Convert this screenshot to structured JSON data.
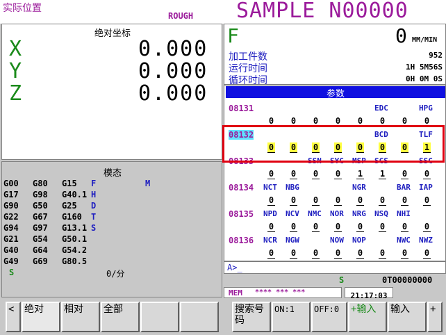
{
  "header": {
    "screen_title": "实际位置",
    "mode": "ROUGH",
    "program": "SAMPLE N00000"
  },
  "position": {
    "title": "绝对坐标",
    "axes": [
      {
        "letter": "X",
        "value": "0.000"
      },
      {
        "letter": "Y",
        "value": "0.000"
      },
      {
        "letter": "Z",
        "value": "0.000"
      }
    ]
  },
  "modal": {
    "title": "模态",
    "rows": [
      [
        "G00",
        "G80",
        "G15",
        "F",
        "M"
      ],
      [
        "G17",
        "G98",
        "G40.1",
        "H",
        ""
      ],
      [
        "G90",
        "G50",
        "G25",
        "D",
        ""
      ],
      [
        "G22",
        "G67",
        "G160",
        "T",
        ""
      ],
      [
        "G94",
        "G97",
        "G13.1",
        "S",
        ""
      ],
      [
        "G21",
        "G54",
        "G50.1",
        "",
        ""
      ],
      [
        "G40",
        "G64",
        "G54.2",
        "",
        ""
      ],
      [
        "G49",
        "G69",
        "G80.5",
        "",
        ""
      ]
    ],
    "s_letter": "S",
    "feed_unit": "0/分"
  },
  "feed": {
    "letter": "F",
    "value": "0",
    "unit": "MM/MIN"
  },
  "counters": [
    {
      "label": "加工件数",
      "value": "952"
    },
    {
      "label": "运行时间",
      "value": "1H 5M56S"
    },
    {
      "label": "循环时间",
      "value": "0H 0M 0S"
    }
  ],
  "params": {
    "title": "参数",
    "rows": [
      {
        "number": "08131",
        "names": [
          "",
          "",
          "",
          "",
          "",
          "EDC",
          "",
          "HPG"
        ],
        "bits": [
          "0",
          "0",
          "0",
          "0",
          "0",
          "0",
          "0",
          "0"
        ]
      },
      {
        "number": "08132",
        "names": [
          "",
          "",
          "",
          "",
          "",
          "BCD",
          "",
          "TLF"
        ],
        "bits": [
          "0",
          "0",
          "0",
          "0",
          "0",
          "0",
          "0",
          "1"
        ]
      },
      {
        "number": "08133",
        "names": [
          "",
          "",
          "SSN",
          "SYC",
          "MSP",
          "SCS",
          "",
          "SSC"
        ],
        "bits": [
          "0",
          "0",
          "0",
          "0",
          "1",
          "1",
          "0",
          "0"
        ]
      },
      {
        "number": "08134",
        "names": [
          "NCT",
          "NBG",
          "",
          "",
          "NGR",
          "",
          "BAR",
          "IAP"
        ],
        "bits": [
          "0",
          "0",
          "0",
          "0",
          "0",
          "0",
          "0",
          "0"
        ]
      },
      {
        "number": "08135",
        "names": [
          "NPD",
          "NCV",
          "NMC",
          "NOR",
          "NRG",
          "NSQ",
          "NHI",
          ""
        ],
        "bits": [
          "0",
          "0",
          "0",
          "0",
          "0",
          "0",
          "0",
          "0"
        ]
      },
      {
        "number": "08136",
        "names": [
          "NCR",
          "NGW",
          "",
          "NOW",
          "NOP",
          "",
          "NWC",
          "NWZ"
        ],
        "bits": [
          "0",
          "0",
          "0",
          "0",
          "0",
          "0",
          "0",
          "0"
        ]
      }
    ]
  },
  "input": {
    "prompt": "A>_"
  },
  "status": {
    "s": "S",
    "t": "0T00000000",
    "mode": "MEM",
    "mode_stars": "**** *** ***",
    "clock": "21:17:03"
  },
  "softkeys": {
    "prev": "<",
    "k1": "绝对",
    "k2": "相对",
    "k3": "全部",
    "k4": "",
    "k5": "",
    "k6": "搜索号码",
    "k7": "ON:1",
    "k8": "OFF:0",
    "k9_plus": "+",
    "k9": "输入",
    "k10": "输入",
    "next": "+"
  },
  "colors": {
    "title": "#9b1b9b",
    "axis": "#1a8a1a",
    "param_name": "#2020c0",
    "selection": "#e00010",
    "highlight": "#ffff40"
  }
}
